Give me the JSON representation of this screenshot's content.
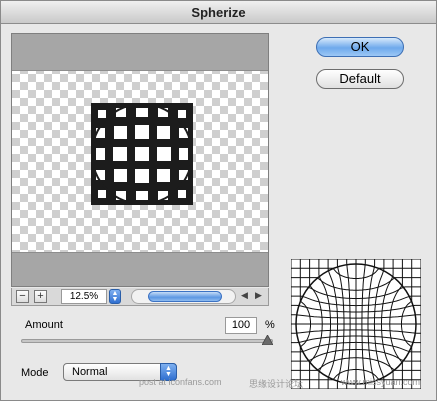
{
  "window": {
    "title": "Spherize"
  },
  "buttons": {
    "ok": "OK",
    "default": "Default"
  },
  "zoom": {
    "minus": "−",
    "plus": "+",
    "value": "12.5%"
  },
  "scroll": {
    "left": "◀",
    "right": "▶"
  },
  "amount": {
    "label": "Amount",
    "value": "100",
    "unit": "%",
    "slider_fraction": 1.0
  },
  "mode": {
    "label": "Mode",
    "value": "Normal"
  },
  "watermark": {
    "left": "post at iconfans.com",
    "middle": "思缘设计论坛",
    "right": "www.missyuan.com"
  },
  "icons": {
    "zoom_out": "minus-icon",
    "zoom_in": "plus-icon",
    "stepper": "up-down-arrows-icon"
  },
  "colors": {
    "accent": "#5c97e2",
    "preview_band": "#a6a6a6"
  }
}
